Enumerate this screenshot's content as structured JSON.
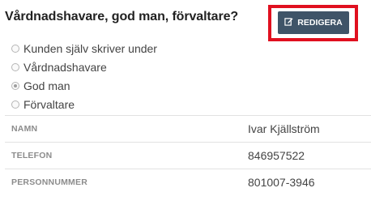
{
  "section": {
    "title": "Vårdnadshavare, god man, förvaltare?",
    "edit_label": "REDIGERA",
    "edit_icon": "edit-icon",
    "highlight_color": "#e0101f",
    "button_color": "#3f5468"
  },
  "options": [
    {
      "label": "Kunden själv skriver under",
      "checked": false
    },
    {
      "label": "Vårdnadshavare",
      "checked": false
    },
    {
      "label": "God man",
      "checked": true
    },
    {
      "label": "Förvaltare",
      "checked": false
    }
  ],
  "fields": [
    {
      "label": "NAMN",
      "value": "Ivar Kjällström"
    },
    {
      "label": "TELEFON",
      "value": "846957522"
    },
    {
      "label": "PERSONNUMMER",
      "value": "801007-3946"
    }
  ]
}
